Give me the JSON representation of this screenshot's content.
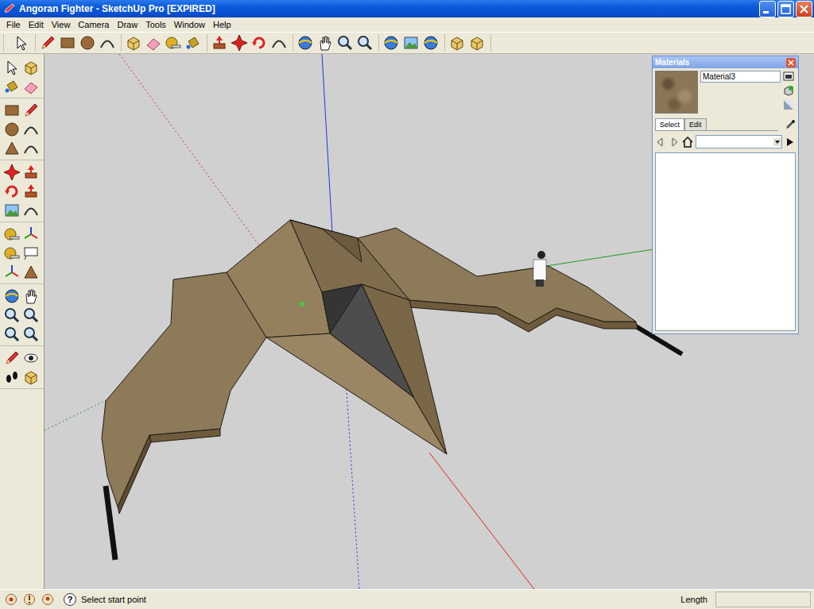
{
  "window": {
    "title": "Angoran Fighter - SketchUp Pro [EXPIRED]"
  },
  "menu": [
    "File",
    "Edit",
    "View",
    "Camera",
    "Draw",
    "Tools",
    "Window",
    "Help"
  ],
  "materials_panel": {
    "title": "Materials",
    "material_name": "Material3",
    "tabs": [
      {
        "label": "Select",
        "selected": true
      },
      {
        "label": "Edit",
        "selected": false
      }
    ]
  },
  "status_bar": {
    "help": "?",
    "hint": "Select start point",
    "measurement_label": "Length"
  }
}
